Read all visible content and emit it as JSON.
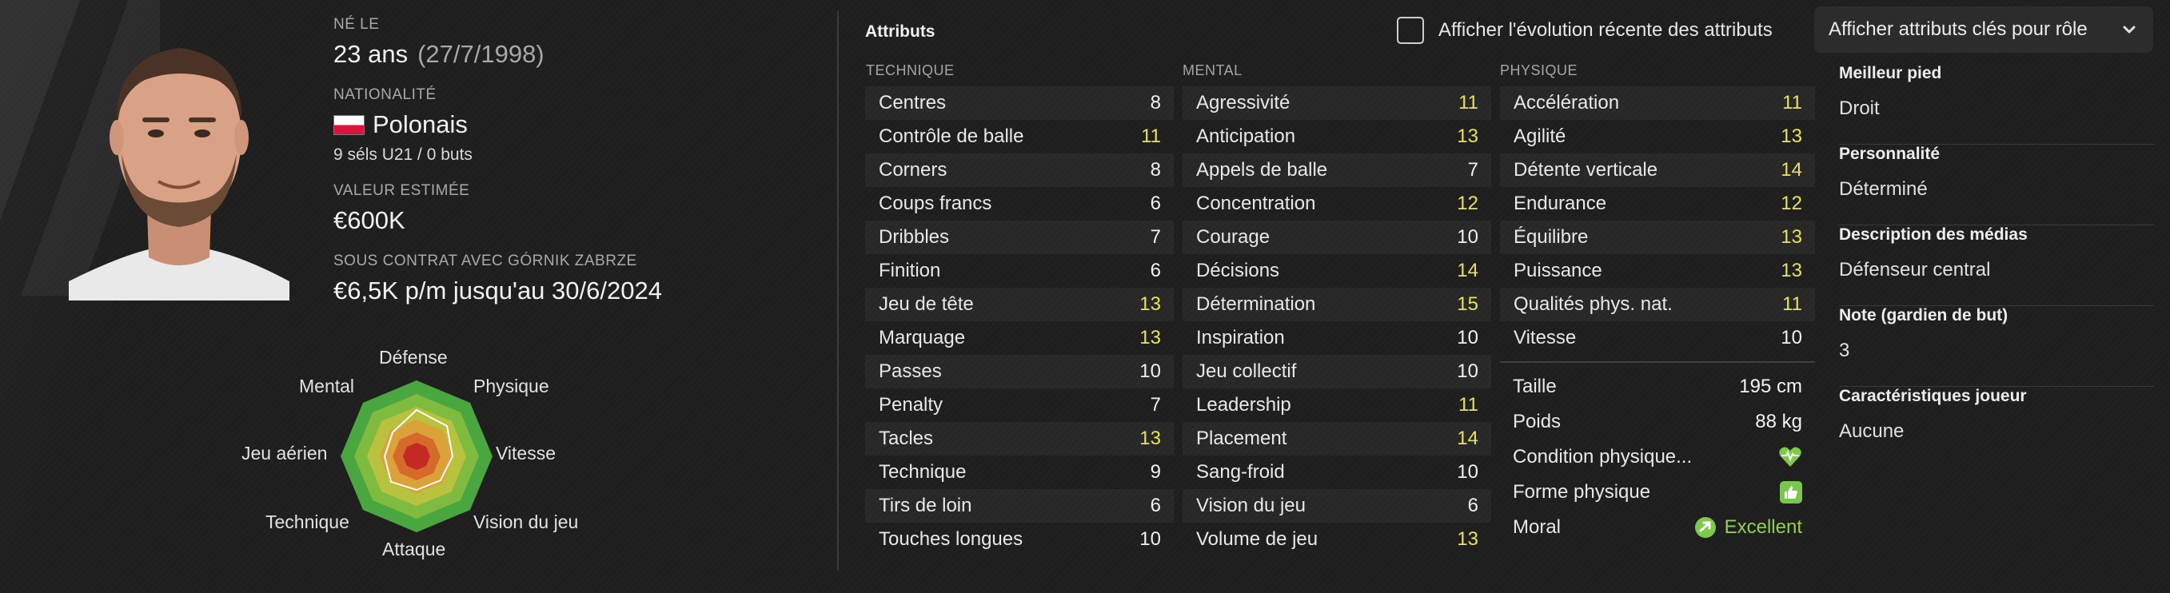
{
  "player": {
    "born_label": "NÉ LE",
    "age": "23 ans",
    "dob": "(27/7/1998)",
    "nationality_label": "NATIONALITÉ",
    "nationality": "Polonais",
    "caps": "9 séls U21 / 0 buts",
    "value_label": "VALEUR ESTIMÉE",
    "value": "€600K",
    "contract_label": "SOUS CONTRAT AVEC GÓRNIK ZABRZE",
    "contract": "€6,5K p/m jusqu'au 30/6/2024"
  },
  "radar": {
    "labels": [
      "Défense",
      "Physique",
      "Vitesse",
      "Vision du jeu",
      "Attaque",
      "Technique",
      "Jeu aérien",
      "Mental"
    ]
  },
  "attributes": {
    "title": "Attributs",
    "show_evolution_label": "Afficher l'évolution récente des attributs",
    "dropdown_label": "Afficher attributs clés pour rôle",
    "technique": {
      "heading": "TECHNIQUE",
      "rows": [
        {
          "name": "Centres",
          "value": "8",
          "key": false
        },
        {
          "name": "Contrôle de balle",
          "value": "11",
          "key": true
        },
        {
          "name": "Corners",
          "value": "8",
          "key": false
        },
        {
          "name": "Coups francs",
          "value": "6",
          "key": false
        },
        {
          "name": "Dribbles",
          "value": "7",
          "key": false
        },
        {
          "name": "Finition",
          "value": "6",
          "key": false
        },
        {
          "name": "Jeu de tête",
          "value": "13",
          "key": true
        },
        {
          "name": "Marquage",
          "value": "13",
          "key": true
        },
        {
          "name": "Passes",
          "value": "10",
          "key": false
        },
        {
          "name": "Penalty",
          "value": "7",
          "key": false
        },
        {
          "name": "Tacles",
          "value": "13",
          "key": true
        },
        {
          "name": "Technique",
          "value": "9",
          "key": false
        },
        {
          "name": "Tirs de loin",
          "value": "6",
          "key": false
        },
        {
          "name": "Touches longues",
          "value": "10",
          "key": false
        }
      ]
    },
    "mental": {
      "heading": "MENTAL",
      "rows": [
        {
          "name": "Agressivité",
          "value": "11",
          "key": true
        },
        {
          "name": "Anticipation",
          "value": "13",
          "key": true
        },
        {
          "name": "Appels de balle",
          "value": "7",
          "key": false
        },
        {
          "name": "Concentration",
          "value": "12",
          "key": true
        },
        {
          "name": "Courage",
          "value": "10",
          "key": false
        },
        {
          "name": "Décisions",
          "value": "14",
          "key": true
        },
        {
          "name": "Détermination",
          "value": "15",
          "key": true
        },
        {
          "name": "Inspiration",
          "value": "10",
          "key": false
        },
        {
          "name": "Jeu collectif",
          "value": "10",
          "key": false
        },
        {
          "name": "Leadership",
          "value": "11",
          "key": true
        },
        {
          "name": "Placement",
          "value": "14",
          "key": true
        },
        {
          "name": "Sang-froid",
          "value": "10",
          "key": false
        },
        {
          "name": "Vision du jeu",
          "value": "6",
          "key": false
        },
        {
          "name": "Volume de jeu",
          "value": "13",
          "key": true
        }
      ]
    },
    "physique": {
      "heading": "PHYSIQUE",
      "rows": [
        {
          "name": "Accélération",
          "value": "11",
          "key": true
        },
        {
          "name": "Agilité",
          "value": "13",
          "key": true
        },
        {
          "name": "Détente verticale",
          "value": "14",
          "key": true
        },
        {
          "name": "Endurance",
          "value": "12",
          "key": true
        },
        {
          "name": "Équilibre",
          "value": "13",
          "key": true
        },
        {
          "name": "Puissance",
          "value": "13",
          "key": true
        },
        {
          "name": "Qualités phys. nat.",
          "value": "11",
          "key": true
        },
        {
          "name": "Vitesse",
          "value": "10",
          "key": false
        }
      ]
    },
    "highlight_color": "#e9e35b"
  },
  "physical_stats": {
    "height_label": "Taille",
    "height": "195 cm",
    "weight_label": "Poids",
    "weight": "88 kg",
    "condition_label": "Condition physique...",
    "condition_icon": "heart-rate-icon",
    "form_label": "Forme physique",
    "form_icon": "thumbs-up-icon",
    "morale_label": "Moral",
    "morale": "Excellent",
    "morale_icon": "arrow-up-circle-icon"
  },
  "profile": {
    "items": [
      {
        "label": "Meilleur pied",
        "value": "Droit"
      },
      {
        "label": "Personnalité",
        "value": "Déterminé"
      },
      {
        "label": "Description des médias",
        "value": "Défenseur central"
      },
      {
        "label": "Note (gardien de but)",
        "value": "3"
      },
      {
        "label": "Caractéristiques joueur",
        "value": "Aucune"
      }
    ]
  }
}
